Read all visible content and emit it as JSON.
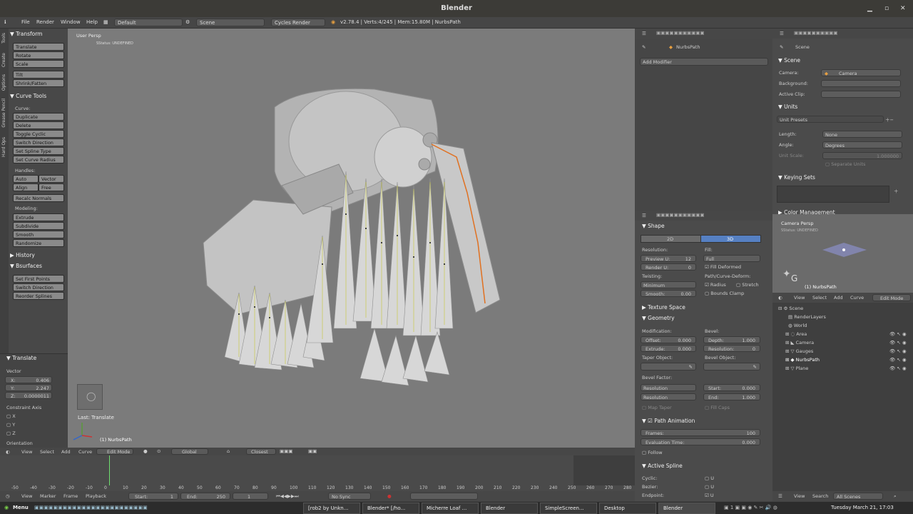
{
  "window": {
    "title": "Blender"
  },
  "infobar": {
    "menus": [
      "File",
      "Render",
      "Window",
      "Help"
    ],
    "layout": "Default",
    "scene": "Scene",
    "engine": "Cycles Render",
    "stats": "v2.78.4 | Verts:4/245 | Mem:15.80M | NurbsPath"
  },
  "toolshelf": {
    "tabs": [
      "Tools",
      "Create",
      "Options",
      "Grease Pencil",
      "Hard Ops"
    ],
    "transform": {
      "title": "Transform",
      "buttons": [
        "Translate",
        "Rotate",
        "Scale",
        "Tilt",
        "Shrink/Fatten"
      ]
    },
    "curve_tools": {
      "title": "Curve Tools",
      "curve_label": "Curve:",
      "buttons": [
        "Duplicate",
        "Delete",
        "Toggle Cyclic",
        "Switch Direction",
        "Set Spline Type",
        "Set Curve Radius"
      ],
      "handles_label": "Handles:",
      "handles": [
        "Auto",
        "Vector",
        "Align",
        "Free"
      ],
      "recalc": "Recalc Normals",
      "modeling_label": "Modeling:",
      "modeling": [
        "Extrude",
        "Subdivide",
        "Smooth",
        "Randomize"
      ]
    },
    "history": {
      "title": "History"
    },
    "bsurfaces": {
      "title": "Bsurfaces",
      "buttons": [
        "Set First Points",
        "Switch Direction",
        "Reorder Splines"
      ]
    },
    "operator": {
      "title": "Translate",
      "vector_label": "Vector",
      "x": "X:",
      "x_val": "0.406",
      "y": "Y:",
      "y_val": "2.247",
      "z": "Z:",
      "z_val": "0.0000011",
      "constraint": "Constraint Axis",
      "cx": "X",
      "cy": "Y",
      "cz": "Z",
      "orientation": "Orientation"
    }
  },
  "viewport": {
    "view_name": "User Persp",
    "status": "SStatus: UNDEFINED",
    "last_op": "Last: Translate",
    "object": "(1) NurbsPath"
  },
  "vpheader": {
    "menus": [
      "View",
      "Select",
      "Add",
      "Curve"
    ],
    "mode": "Edit Mode",
    "orientation": "Global",
    "snap": "Closest"
  },
  "timeline": {
    "ticks": [
      "-50",
      "-40",
      "-30",
      "-20",
      "-10",
      "0",
      "10",
      "20",
      "30",
      "40",
      "50",
      "60",
      "70",
      "80",
      "90",
      "100",
      "110",
      "120",
      "130",
      "140",
      "150",
      "160",
      "170",
      "180",
      "190",
      "200",
      "210",
      "220",
      "230",
      "240",
      "250",
      "260",
      "270",
      "280"
    ],
    "menus": [
      "View",
      "Marker",
      "Frame",
      "Playback"
    ],
    "start": "Start:",
    "start_val": "1",
    "end": "End:",
    "end_val": "250",
    "current": "1",
    "sync": "No Sync"
  },
  "modifiers": {
    "object": "NurbsPath",
    "add": "Add Modifier"
  },
  "data_props": {
    "shape": {
      "title": "Shape",
      "d2": "2D",
      "d3": "3D",
      "resolution": "Resolution:",
      "preview_u": "Preview U:",
      "preview_u_val": "12",
      "render_u": "Render U:",
      "render_u_val": "0",
      "twisting": "Twisting:",
      "twist_val": "Minimum",
      "smooth": "Smooth:",
      "smooth_val": "0.00",
      "fill": "Fill:",
      "fill_val": "Full",
      "fill_deformed": "Fill Deformed",
      "path_deform": "Path/Curve-Deform:",
      "radius": "Radius",
      "stretch": "Stretch",
      "bounds": "Bounds Clamp"
    },
    "texture_space": "Texture Space",
    "geometry": {
      "title": "Geometry",
      "modification": "Modification:",
      "offset": "Offset:",
      "offset_val": "0.000",
      "extrude": "Extrude:",
      "extrude_val": "0.000",
      "bevel": "Bevel:",
      "depth": "Depth:",
      "depth_val": "1.000",
      "resolution": "Resolution:",
      "resolution_val": "0",
      "taper": "Taper Object:",
      "bevel_obj": "Bevel Object:",
      "bevel_factor": "Bevel Factor:",
      "res1": "Resolution",
      "res2": "Resolution",
      "start": "Start:",
      "start_val": "0.000",
      "end": "End:",
      "end_val": "1.000",
      "map_taper": "Map Taper",
      "fill_caps": "Fill Caps"
    },
    "path_anim": {
      "title": "Path Animation",
      "frames": "Frames:",
      "frames_val": "100",
      "eval": "Evaluation Time:",
      "eval_val": "0.000",
      "follow": "Follow"
    },
    "active_spline": {
      "title": "Active Spline",
      "cyclic": "Cyclic:",
      "bezier": "Bezier:",
      "endpoint": "Endpoint:",
      "u": "U"
    }
  },
  "scene_props": {
    "crumb": "Scene",
    "scene": {
      "title": "Scene",
      "camera": "Camera:",
      "camera_val": "Camera",
      "background": "Background:",
      "active_clip": "Active Clip:"
    },
    "units": {
      "title": "Units",
      "presets": "Unit Presets",
      "length": "Length:",
      "length_val": "None",
      "angle": "Angle:",
      "angle_val": "Degrees",
      "unit_scale": "Unit Scale:",
      "unit_scale_val": "1.000000",
      "separate": "Separate Units"
    },
    "keying": "Keying Sets",
    "color_mgmt": "Color Management"
  },
  "camview": {
    "title": "Camera Persp",
    "status": "SStatus: UNDEFINED",
    "object": "(1) NurbsPath",
    "menus": [
      "View",
      "Select",
      "Add",
      "Curve"
    ],
    "mode": "Edit Mode"
  },
  "outliner": {
    "items": [
      "Scene",
      "RenderLayers",
      "World",
      "Area",
      "Camera",
      "Gauges",
      "NurbsPath",
      "Plane"
    ],
    "menus": [
      "View",
      "Search"
    ],
    "filter": "All Scenes"
  },
  "taskbar": {
    "menu": "Menu",
    "tasks": [
      "[rob2 by Unkn...",
      "Blender* [/ho...",
      "Micherre Loaf ...",
      "Blender",
      "SimpleScreen...",
      "Desktop",
      "Blender"
    ],
    "clock": "Tuesday March 21, 17:03"
  },
  "colors": {
    "orange_path": "#e07020",
    "yellow_curve": "#c8c832",
    "header_blue": "#5680c2"
  }
}
